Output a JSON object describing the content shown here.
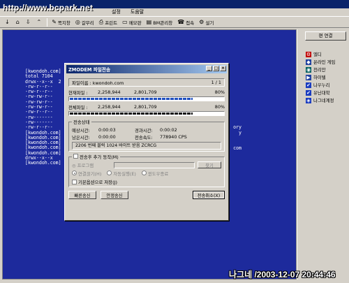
{
  "watermark": "http://www.bcpark.net",
  "menu": [
    "설정",
    "도움말"
  ],
  "toolbar": [
    {
      "icon": "↓",
      "label": ""
    },
    {
      "icon": "⌂",
      "label": ""
    },
    {
      "icon": "⇩",
      "label": ""
    },
    {
      "icon": "⌃",
      "label": ""
    },
    {
      "icon": "✎",
      "label": "쪽지창"
    },
    {
      "icon": "◎",
      "label": "갈무리"
    },
    {
      "icon": "⎙",
      "label": "프린트"
    },
    {
      "icon": "▭",
      "label": "메모판"
    },
    {
      "icon": "▤",
      "label": "BM관리창"
    },
    {
      "icon": "☎",
      "label": "접속"
    },
    {
      "icon": "⚙",
      "label": "설기"
    }
  ],
  "terminal": {
    "lines": [
      "[kwondoh.com]",
      "total 7104",
      "drwx--x--x  2",
      "-rw-r--r--",
      "-rw-r--r--",
      "-rw-rw-r--",
      "-rw-rw-r--",
      "-rw-rw-r--",
      "-rw-r--r--",
      "-rw-------",
      "-rw-------",
      "-rw-r--r--",
      "[kwondoh.com]",
      "[kwondoh.com]",
      "[kwondoh.com]",
      "[kwondoh.com]",
      "[kwondoh.com]",
      "drwx--x--x",
      "[kwondoh.com]"
    ],
    "right": [
      {
        "row": 11,
        "text": "ory"
      },
      {
        "row": 12,
        "text": "y"
      },
      {
        "row": 15,
        "text": "com"
      }
    ]
  },
  "side": {
    "button": "편 연결",
    "items": [
      {
        "label": "엘디",
        "icon": "⚙",
        "color": "#c00000"
      },
      {
        "label": "온라인 게임",
        "icon": "◆",
        "color": "#2040a0"
      },
      {
        "label": "천리안",
        "icon": "◉",
        "color": "#006060"
      },
      {
        "label": "하이텔",
        "icon": "▶",
        "color": "#2040a0"
      },
      {
        "label": "나우누리",
        "icon": "✔",
        "color": "#1a3cc0"
      },
      {
        "label": "유닌대학",
        "icon": "✔",
        "color": "#1a3cc0"
      },
      {
        "label": "나그네계정",
        "icon": "◈",
        "color": "#1a3cc0"
      }
    ]
  },
  "stamp": "나그네 /2003-12-07 20:44:46",
  "dialog": {
    "title": "ZMODEM 파일전송",
    "filename_label": "파일이름 :",
    "filename": "kwondoh.com",
    "file_count": "1 / 1",
    "current_label": "현재파일 :",
    "current_done": "2,258,944",
    "current_total": "2,801,709",
    "current_pct": "80%",
    "current_fraction": 0.8,
    "total_label": "전체파일 :",
    "total_done": "2,258,944",
    "total_total": "2,801,709",
    "total_pct": "80%",
    "total_fraction": 0.8,
    "status_group": "전송상태",
    "estimated_label": "예상시간:",
    "estimated": "0:00:03",
    "elapsed_label": "경과시간:",
    "elapsed": "0:00:02",
    "remaining_label": "남은시간:",
    "remaining": "0:00:00",
    "speed_label": "전송속도:",
    "speed": "778940 CPS",
    "status_msg": "2206 번째 블럭 1024 바이트 받음 ZCRCG",
    "after_group": "전송후 추가 동작(M)",
    "run_label": "◎ 프로그램",
    "find_btn": "찾기",
    "radio1": "연결끊기(H)",
    "radio2": "자동실행(E)",
    "radio3": "윈도우종료",
    "default_check": "기본옵션으로 저장(J)",
    "btn_fast": "빠른송신",
    "btn_stable": "안정송신",
    "btn_cancel": "전송취소(X)"
  }
}
